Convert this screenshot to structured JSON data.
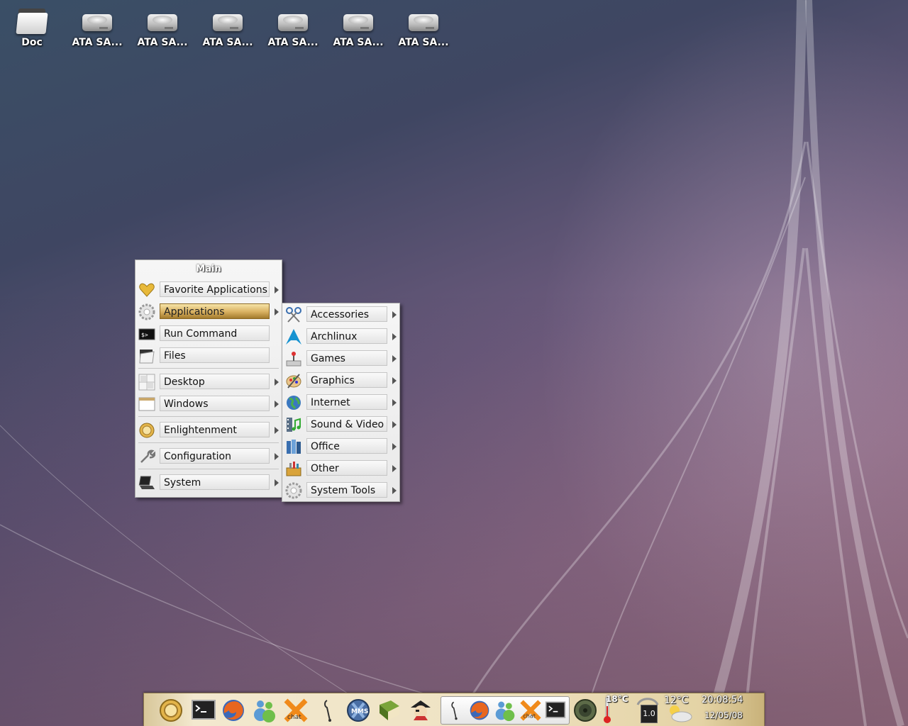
{
  "desktop": {
    "icons": [
      {
        "label": "Doc",
        "icon": "folder-icon"
      },
      {
        "label": "ATA SA...",
        "icon": "hard-drive-icon"
      },
      {
        "label": "ATA SA...",
        "icon": "hard-drive-icon"
      },
      {
        "label": "ATA SA...",
        "icon": "hard-drive-icon"
      },
      {
        "label": "ATA SA...",
        "icon": "hard-drive-icon"
      },
      {
        "label": "ATA SA...",
        "icon": "hard-drive-icon"
      },
      {
        "label": "ATA SA...",
        "icon": "hard-drive-icon"
      }
    ]
  },
  "main_menu": {
    "title": "Main",
    "items": [
      {
        "label": "Favorite Applications",
        "icon": "heart-icon",
        "submenu": true
      },
      {
        "label": "Applications",
        "icon": "gear-icon",
        "submenu": true,
        "selected": true
      },
      {
        "label": "Run Command",
        "icon": "terminal-icon",
        "submenu": false
      },
      {
        "label": "Files",
        "icon": "folder-icon",
        "submenu": false
      },
      {
        "label": "Desktop",
        "icon": "desktop-icon",
        "submenu": true
      },
      {
        "label": "Windows",
        "icon": "window-icon",
        "submenu": true
      },
      {
        "label": "Enlightenment",
        "icon": "enlightenment-icon",
        "submenu": true
      },
      {
        "label": "Configuration",
        "icon": "wrench-icon",
        "submenu": true
      },
      {
        "label": "System",
        "icon": "laptop-icon",
        "submenu": true
      }
    ]
  },
  "apps_menu": {
    "items": [
      {
        "label": "Accessories",
        "icon": "scissors-icon"
      },
      {
        "label": "Archlinux",
        "icon": "arch-logo-icon"
      },
      {
        "label": "Games",
        "icon": "joystick-icon"
      },
      {
        "label": "Graphics",
        "icon": "palette-icon"
      },
      {
        "label": "Internet",
        "icon": "globe-icon"
      },
      {
        "label": "Sound & Video",
        "icon": "music-film-icon"
      },
      {
        "label": "Office",
        "icon": "office-icon"
      },
      {
        "label": "Other",
        "icon": "toolbox-icon"
      },
      {
        "label": "System Tools",
        "icon": "gear-icon"
      }
    ]
  },
  "taskbar": {
    "launchers": [
      "enlightenment-start-icon",
      "terminal-icon",
      "firefox-icon",
      "messenger-icon",
      "xchat-icon",
      "audio-player-icon",
      "mms-icon",
      "book-icon",
      "pirate-icon"
    ],
    "pager_apps": [
      "audio-player-icon",
      "firefox-icon",
      "messenger-icon",
      "xchat-icon",
      "terminal-icon"
    ],
    "temperature": "18°C",
    "cpu_value": "1.0",
    "weather_temp": "12°C",
    "time": "20:08:54",
    "date": "12/05/08",
    "colors": {
      "selected_item": "#d8b060",
      "taskbar": "#efe3c4"
    }
  }
}
